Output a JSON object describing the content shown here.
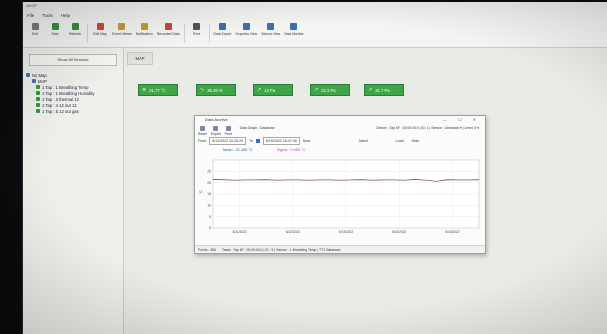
{
  "window": {
    "title": "AKCP",
    "controls": "— ☐ ✕"
  },
  "menu": [
    "File",
    "Tools",
    "Help"
  ],
  "toolbar": [
    {
      "label": "Exit",
      "color": "#7a7a7a"
    },
    {
      "label": "Start",
      "color": "#3c8d40"
    },
    {
      "label": "Refresh",
      "color": "#3c8d40"
    },
    {
      "label": "Edit Map",
      "color": "#d6452e"
    },
    {
      "label": "Event Viewer",
      "color": "#c79a2e"
    },
    {
      "label": "Notification",
      "color": "#c79a2e"
    },
    {
      "label": "Recorded Data",
      "color": "#c04a3a"
    },
    {
      "label": "Print",
      "color": "#555555"
    },
    {
      "label": "Data Export",
      "color": "#3a6fb0"
    },
    {
      "label": "Graphics View",
      "color": "#3a6fb0"
    },
    {
      "label": "Sensor View",
      "color": "#3a6fb0"
    },
    {
      "label": "Data Monitor",
      "color": "#3a6fb0"
    }
  ],
  "left_panel": {
    "show_sensors_label": "Show All Sensors",
    "tree": [
      {
        "label": "No Map",
        "level": "root"
      },
      {
        "label": "MAP",
        "level": "sub"
      },
      {
        "label": "1 Tap : 1 Breathing Temp",
        "level": "leaf"
      },
      {
        "label": "1 Tap : 1 Breathing Humidity",
        "level": "leaf"
      },
      {
        "label": "1 Tap : 3 thermal 12",
        "level": "leaf"
      },
      {
        "label": "1 Tap : 4 12 out 12",
        "level": "leaf"
      },
      {
        "label": "1 Tap : 5 12 out gas",
        "level": "leaf"
      }
    ]
  },
  "map_tab_label": "MAP",
  "tiles": [
    {
      "value": "21.77 °C",
      "sub": "",
      "icon": "thermometer-icon"
    },
    {
      "value": "36.46 %",
      "sub": "",
      "icon": "humidity-icon"
    },
    {
      "value": "14 Pa",
      "sub": "",
      "icon": "pressure-icon"
    },
    {
      "value": "22.3 Pa",
      "sub": "",
      "icon": "pressure-icon"
    },
    {
      "value": "31.7 Pa",
      "sub": "",
      "icon": "pressure-icon"
    }
  ],
  "archive": {
    "title": "Data Archive",
    "tools": [
      "Reset",
      "Export",
      "Print"
    ],
    "duration_label": "Data Graph : Database",
    "sequence_label": "Device : Tap 6F : 00:00:00:0 | ID: 1 | Sensor : Unknown ▾ | Level: 5 ▾",
    "from_label": "From",
    "from_value": "6/11/2022 20:26:20",
    "to_label": "To",
    "to_value": "6/15/2022 16:47:06",
    "now_label": "Now",
    "max_label": "Max/I",
    "load_label": "Load",
    "hide_label": "Hide",
    "mean_label": "Mean : 21.165 °C",
    "sigma_label": "Sigma : 0.083 °C",
    "status": [
      "Points : 386",
      "Tasks : Tap 6F : 00:00:00:0 | ID : 5 | Sensor : 1 Breathing Temp | TT/I Database"
    ]
  },
  "chart_data": {
    "type": "line",
    "ylabel": "°C",
    "ylim": [
      0,
      30
    ],
    "yticks": [
      "25",
      "20",
      "15",
      "10",
      "5",
      "0"
    ],
    "xticks": [
      "6/11/2022",
      "6/12/2022",
      "6/13/2022",
      "6/14/2022",
      "6/15/2022"
    ],
    "grid": true,
    "series": [
      {
        "color": "#6a2e66",
        "x": [
          0,
          0.04,
          0.08,
          0.12,
          0.16,
          0.2,
          0.24,
          0.28,
          0.32,
          0.36,
          0.4,
          0.44,
          0.48,
          0.52,
          0.56,
          0.6,
          0.64,
          0.68,
          0.72,
          0.76,
          0.8,
          0.84,
          0.88,
          0.92,
          0.96,
          1
        ],
        "values": [
          21.4,
          21.3,
          21.1,
          21.2,
          21.2,
          21.3,
          21.1,
          21.2,
          21.2,
          21.1,
          21.2,
          21.2,
          21.1,
          21.2,
          21.3,
          21.1,
          21.2,
          21.2,
          21.1,
          21.4,
          21.1,
          20.6,
          21.3,
          21.2,
          21.2,
          21.3
        ]
      }
    ]
  },
  "colors": {
    "tile_green": "#3fa548",
    "accent_blue": "#3570c5"
  }
}
